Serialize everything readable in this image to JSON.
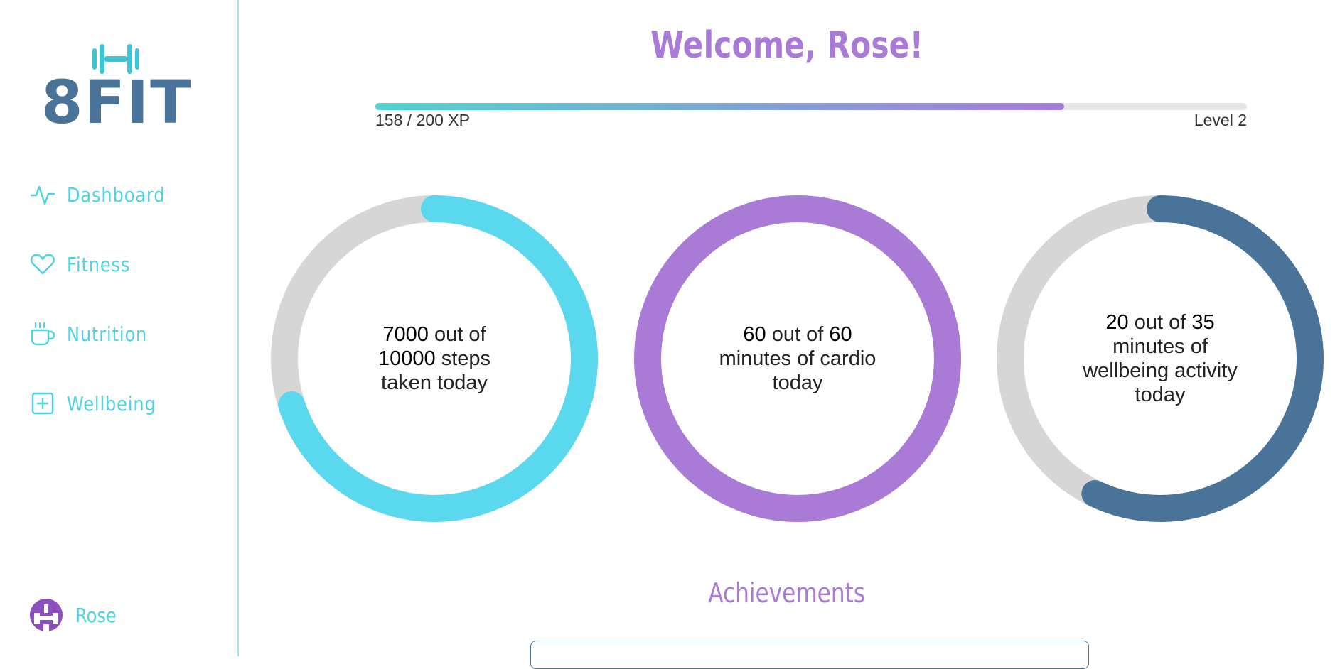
{
  "app": {
    "logo_text": "8FIT",
    "colors": {
      "accent_cyan": "#4fd3e0",
      "accent_purple": "#a97bd6",
      "brand_blue": "#4a7399",
      "ring_track": "#d6d6d6"
    }
  },
  "sidebar": {
    "items": [
      {
        "label": "Dashboard",
        "icon": "activity-icon"
      },
      {
        "label": "Fitness",
        "icon": "heart-icon"
      },
      {
        "label": "Nutrition",
        "icon": "coffee-cup-icon"
      },
      {
        "label": "Wellbeing",
        "icon": "plus-square-icon"
      }
    ],
    "user": {
      "name": "Rose",
      "icon": "avatar"
    }
  },
  "header": {
    "welcome": "Welcome, Rose!"
  },
  "xp": {
    "current": 158,
    "max": 200,
    "label": "158 / 200 XP",
    "level_label": "Level 2"
  },
  "rings": [
    {
      "value": "7000",
      "word_out_of": "out of",
      "goal": "10000",
      "line_suffix": "steps",
      "rest": "taken today",
      "progress": 0.7,
      "color": "#5ad8ee"
    },
    {
      "value": "60",
      "word_out_of": "out of",
      "goal": "60",
      "line_suffix": "minutes of cardio",
      "rest": "today",
      "progress": 1.0,
      "color": "#a97bd6"
    },
    {
      "value": "20",
      "word_out_of": "out of",
      "goal": "35",
      "line_suffix": "minutes of",
      "rest": "wellbeing activity today",
      "progress": 0.5714,
      "color": "#4a7399"
    }
  ],
  "achievements": {
    "title": "Achievements"
  }
}
